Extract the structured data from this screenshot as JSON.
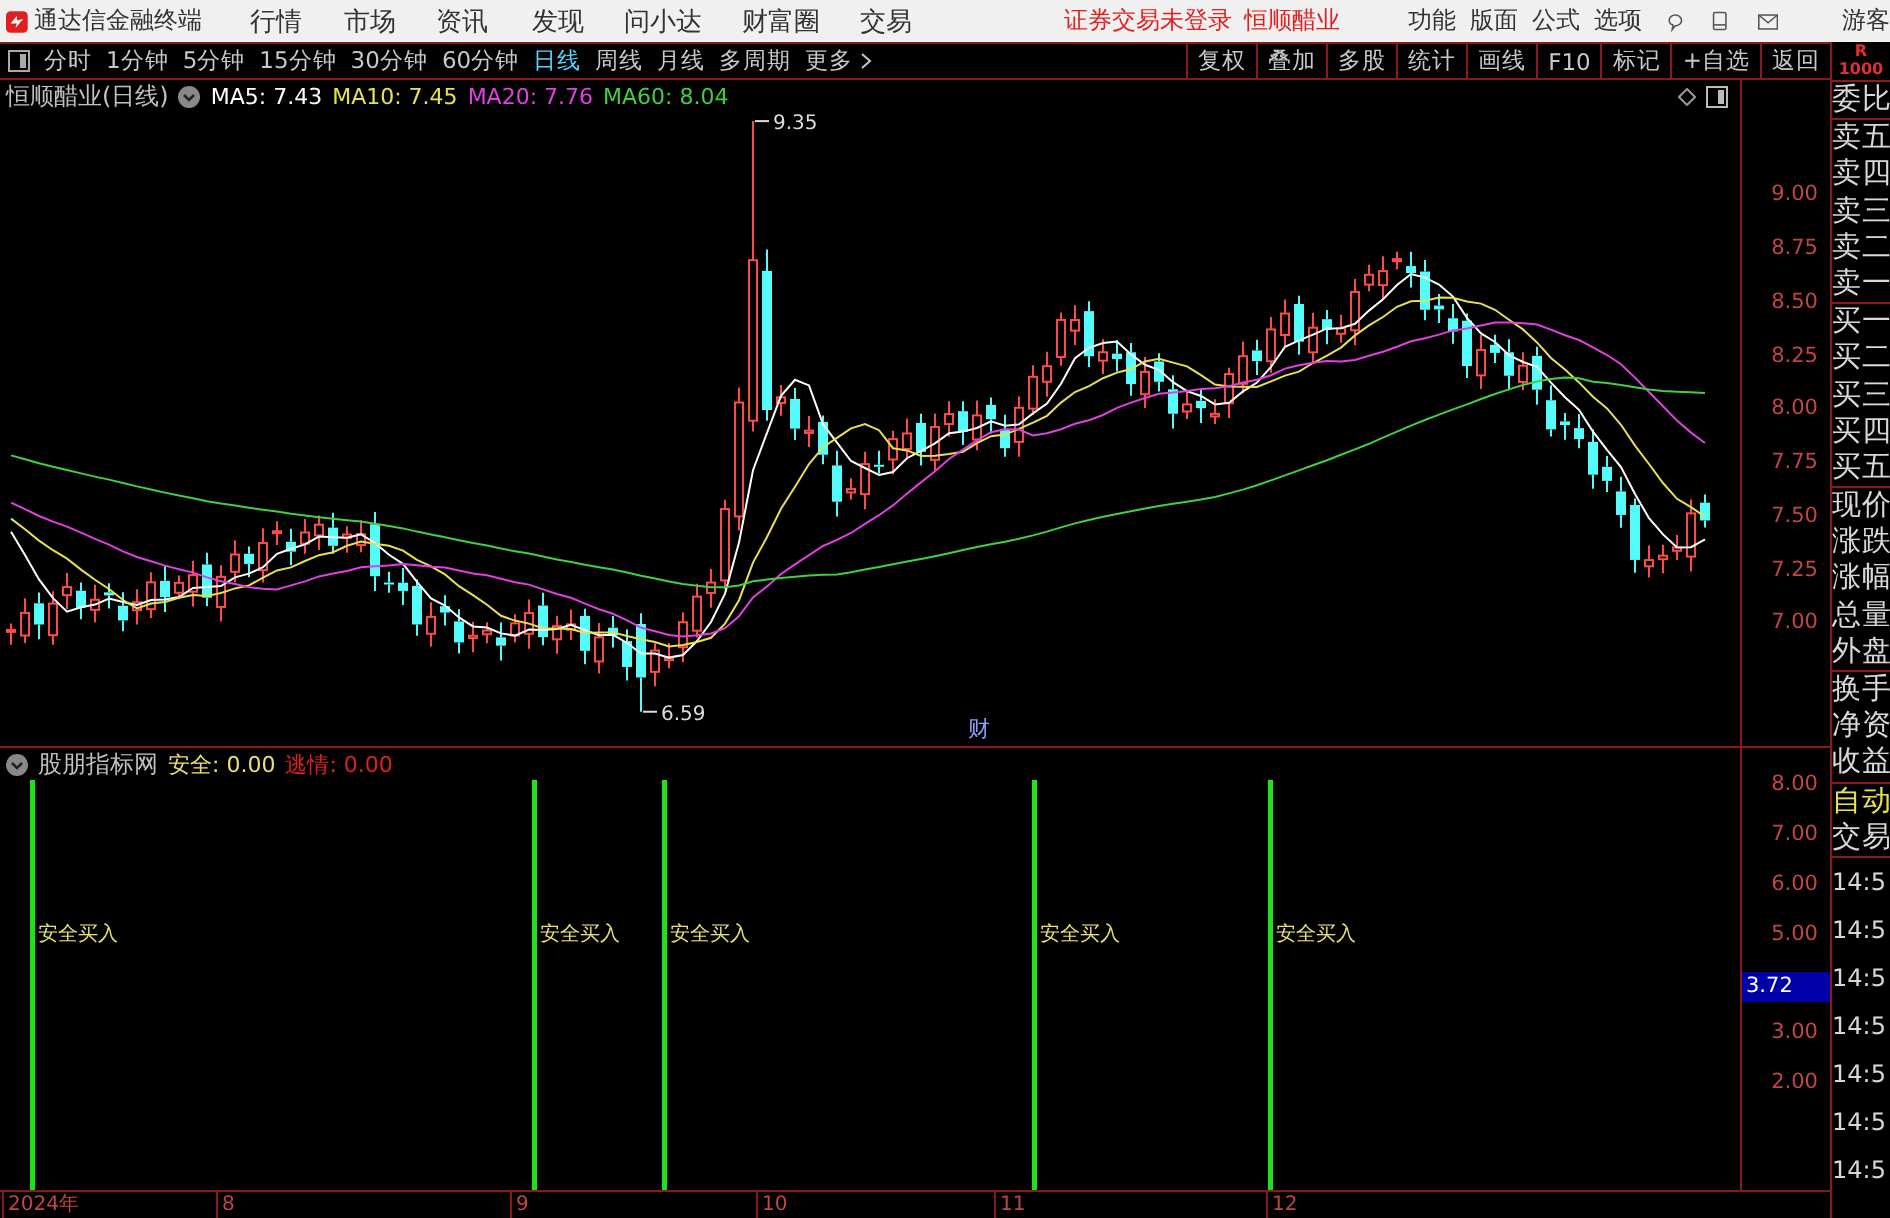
{
  "menubar": {
    "app_title": "通达信金融终端",
    "menus": [
      "行情",
      "市场",
      "资讯",
      "发现",
      "问小达",
      "财富圈",
      "交易"
    ],
    "login_status": "证券交易未登录",
    "stock_name": "恒顺醋业",
    "tools": [
      "功能",
      "版面",
      "公式",
      "选项"
    ],
    "user": "游客"
  },
  "toolbar": {
    "periods": [
      {
        "label": "分时",
        "selected": false
      },
      {
        "label": "1分钟",
        "selected": false
      },
      {
        "label": "5分钟",
        "selected": false
      },
      {
        "label": "15分钟",
        "selected": false
      },
      {
        "label": "30分钟",
        "selected": false
      },
      {
        "label": "60分钟",
        "selected": false
      },
      {
        "label": "日线",
        "selected": true
      },
      {
        "label": "周线",
        "selected": false
      },
      {
        "label": "月线",
        "selected": false
      },
      {
        "label": "多周期",
        "selected": false
      }
    ],
    "more": "更多",
    "actions": [
      "复权",
      "叠加",
      "多股",
      "统计",
      "画线",
      "F10",
      "标记",
      "+自选",
      "返回"
    ]
  },
  "kline": {
    "title": "恒顺醋业(日线)",
    "ma": [
      {
        "label": "MA5: 7.43",
        "color": "#ffffff"
      },
      {
        "label": "MA10: 7.45",
        "color": "#e8e050"
      },
      {
        "label": "MA20: 7.76",
        "color": "#e040e0"
      },
      {
        "label": "MA60: 8.04",
        "color": "#40d040"
      }
    ],
    "high_label": "9.35",
    "low_label": "6.59",
    "event_marker": "财",
    "price_ticks": [
      "9.00",
      "8.75",
      "8.50",
      "8.25",
      "8.00",
      "7.75",
      "7.50",
      "7.25",
      "7.00"
    ]
  },
  "indicator": {
    "name": "股朋指标网",
    "values": [
      {
        "label": "安全: 0.00",
        "color": "#e8e070"
      },
      {
        "label": "逃情: 0.00",
        "color": "#e02020"
      }
    ],
    "ticks": [
      "8.00",
      "7.00",
      "6.00",
      "5.00",
      "3.00",
      "2.00"
    ],
    "cursor_value": "3.72",
    "signals": [
      {
        "label": "安全买入"
      },
      {
        "label": "安全买入"
      },
      {
        "label": "安全买入"
      },
      {
        "label": "安全买入"
      },
      {
        "label": "安全买入"
      }
    ]
  },
  "xaxis": [
    "2024年",
    "8",
    "9",
    "10",
    "11",
    "12"
  ],
  "side_panel": {
    "header": [
      "R",
      "1000"
    ],
    "groups": [
      [
        "委比"
      ],
      [
        "卖五",
        "卖四",
        "卖三",
        "卖二",
        "卖一"
      ],
      [
        "买一",
        "买二",
        "买三",
        "买四",
        "买五"
      ],
      [
        "现价",
        "涨跌",
        "涨幅",
        "总量",
        "外盘"
      ],
      [
        "换手",
        "净资",
        "收益"
      ],
      [
        {
          "label": "自动",
          "highlighted": true
        },
        {
          "label": "交易",
          "highlighted": false
        }
      ],
      [
        "14:5",
        "14:5",
        "14:5",
        "14:5",
        "14:5",
        "14:5",
        "14:5"
      ]
    ]
  }
}
